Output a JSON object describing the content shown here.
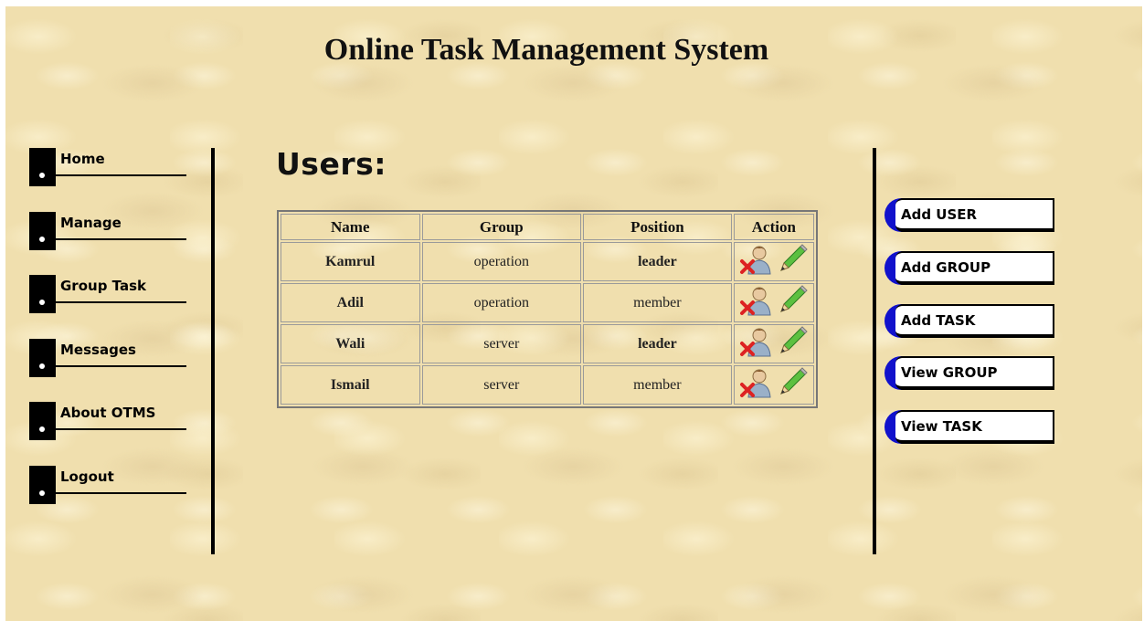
{
  "header": {
    "title": "Online Task Management System"
  },
  "nav": {
    "items": [
      {
        "label": "Home"
      },
      {
        "label": "Manage"
      },
      {
        "label": "Group Task"
      },
      {
        "label": "Messages"
      },
      {
        "label": "About OTMS"
      },
      {
        "label": "Logout"
      }
    ]
  },
  "main": {
    "heading": "Users:",
    "table": {
      "columns": [
        "Name",
        "Group",
        "Position",
        "Action"
      ],
      "rows": [
        {
          "name": "Kamrul",
          "group": "operation",
          "position": "leader"
        },
        {
          "name": "Adil",
          "group": "operation",
          "position": "member"
        },
        {
          "name": "Wali",
          "group": "server",
          "position": "leader"
        },
        {
          "name": "Ismail",
          "group": "server",
          "position": "member"
        }
      ],
      "action_icons": [
        "delete-user-icon",
        "edit-pencil-icon"
      ]
    }
  },
  "side_actions": {
    "items": [
      {
        "label": "Add USER"
      },
      {
        "label": "Add GROUP"
      },
      {
        "label": "Add TASK"
      },
      {
        "label": "View GROUP"
      },
      {
        "label": "View TASK"
      }
    ]
  },
  "colors": {
    "background": "#f0dfae",
    "leader_text": "#cc1111",
    "button_cap": "#1111cc"
  }
}
